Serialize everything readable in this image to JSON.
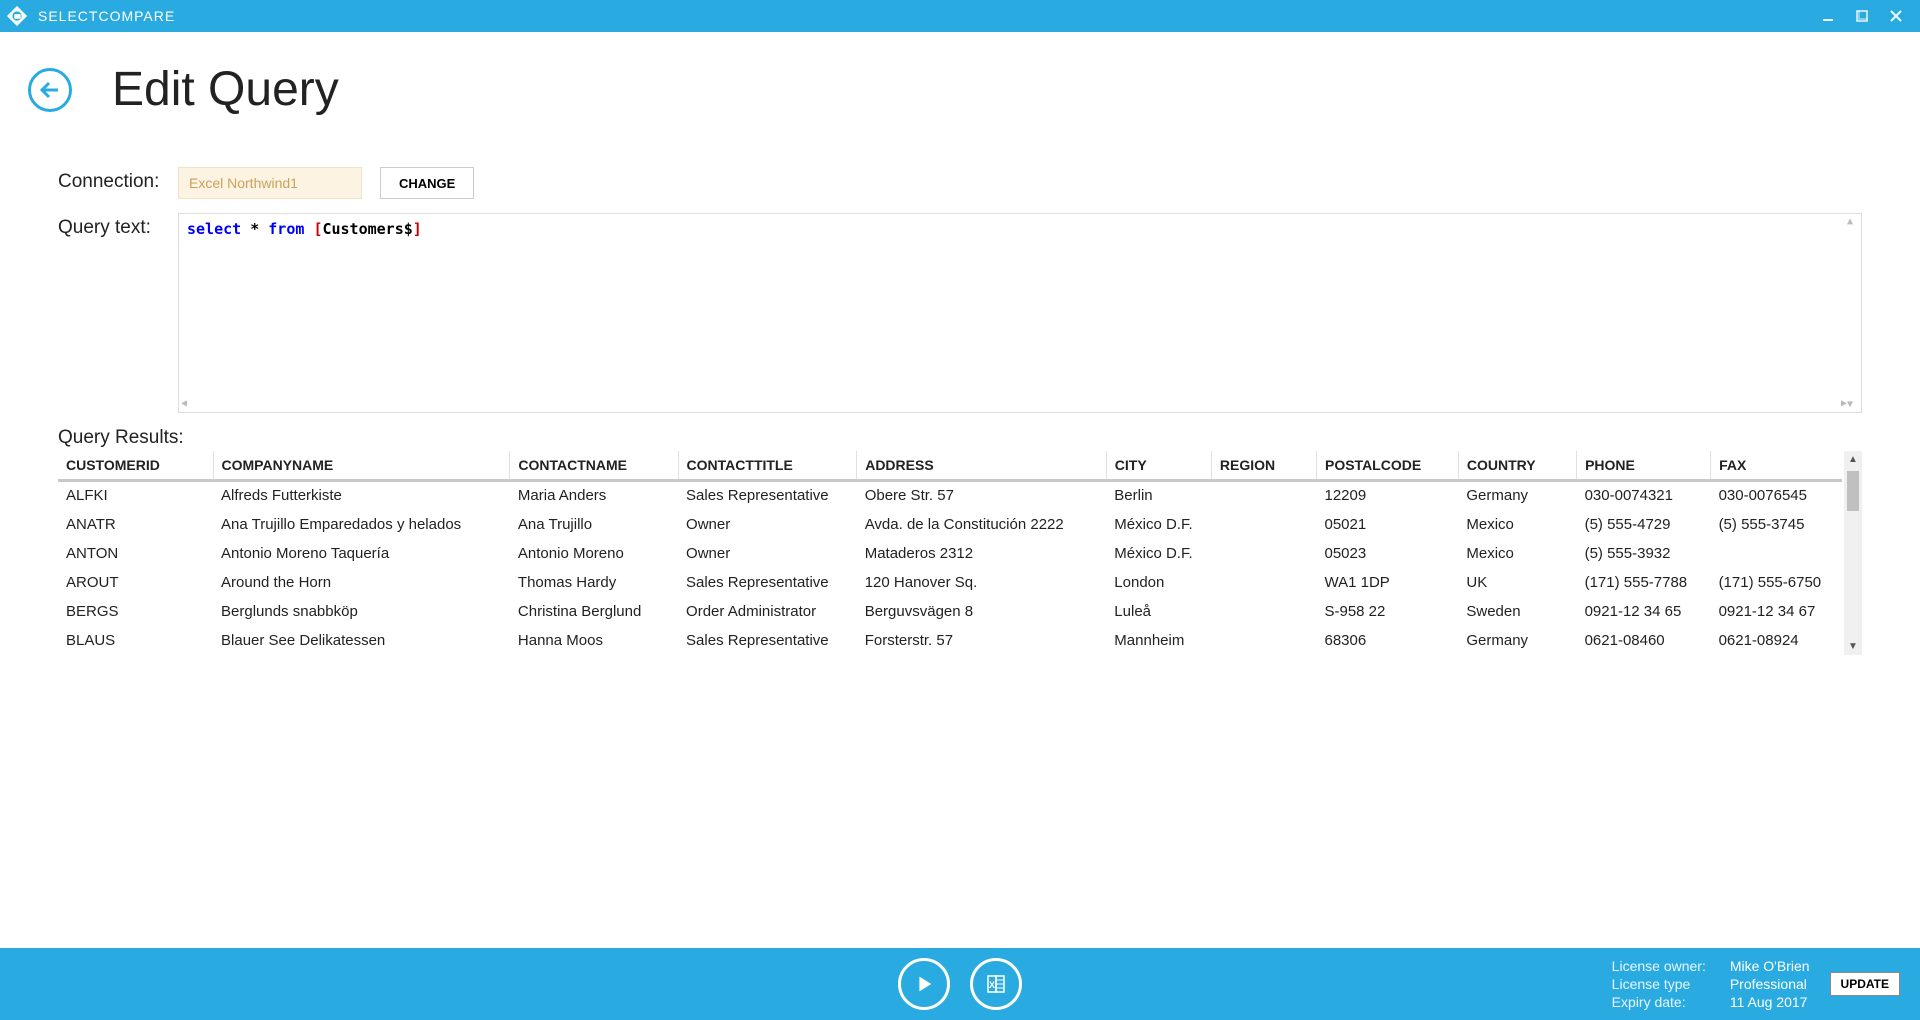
{
  "app": {
    "title": "SELECTCOMPARE"
  },
  "header": {
    "page_title": "Edit Query"
  },
  "form": {
    "connection_label": "Connection:",
    "connection_value": "Excel Northwind1",
    "change_label": "CHANGE",
    "query_label": "Query text:",
    "query": {
      "kw1": "select",
      "star": " * ",
      "kw2": "from",
      "space": " ",
      "br1": "[",
      "table": "Customers$",
      "br2": "]"
    }
  },
  "results": {
    "label": "Query Results:",
    "columns": [
      "CUSTOMERID",
      "COMPANYNAME",
      "CONTACTNAME",
      "CONTACTTITLE",
      "ADDRESS",
      "CITY",
      "REGION",
      "POSTALCODE",
      "COUNTRY",
      "PHONE",
      "FAX"
    ],
    "rows": [
      {
        "customerid": "ALFKI",
        "companyname": "Alfreds Futterkiste",
        "contactname": "Maria Anders",
        "contacttitle": "Sales Representative",
        "address": "Obere Str. 57",
        "city": "Berlin",
        "region": "",
        "postalcode": "12209",
        "country": "Germany",
        "phone": "030-0074321",
        "fax": "030-0076545"
      },
      {
        "customerid": "ANATR",
        "companyname": "Ana Trujillo Emparedados y helados",
        "contactname": "Ana Trujillo",
        "contacttitle": "Owner",
        "address": "Avda. de la Constitución 2222",
        "city": "México D.F.",
        "region": "",
        "postalcode": "05021",
        "country": "Mexico",
        "phone": "(5) 555-4729",
        "fax": "(5) 555-3745"
      },
      {
        "customerid": "ANTON",
        "companyname": "Antonio Moreno Taquería",
        "contactname": "Antonio Moreno",
        "contacttitle": "Owner",
        "address": "Mataderos  2312",
        "city": "México D.F.",
        "region": "",
        "postalcode": "05023",
        "country": "Mexico",
        "phone": "(5) 555-3932",
        "fax": ""
      },
      {
        "customerid": "AROUT",
        "companyname": "Around the Horn",
        "contactname": "Thomas Hardy",
        "contacttitle": "Sales Representative",
        "address": "120 Hanover Sq.",
        "city": "London",
        "region": "",
        "postalcode": "WA1 1DP",
        "country": "UK",
        "phone": "(171) 555-7788",
        "fax": "(171) 555-6750"
      },
      {
        "customerid": "BERGS",
        "companyname": "Berglunds snabbköp",
        "contactname": "Christina Berglund",
        "contacttitle": "Order Administrator",
        "address": "Berguvsvägen  8",
        "city": "Luleå",
        "region": "",
        "postalcode": "S-958 22",
        "country": "Sweden",
        "phone": "0921-12 34 65",
        "fax": "0921-12 34 67"
      },
      {
        "customerid": "BLAUS",
        "companyname": "Blauer See Delikatessen",
        "contactname": "Hanna Moos",
        "contacttitle": "Sales Representative",
        "address": "Forsterstr. 57",
        "city": "Mannheim",
        "region": "",
        "postalcode": "68306",
        "country": "Germany",
        "phone": "0621-08460",
        "fax": "0621-08924"
      }
    ]
  },
  "footer": {
    "license_owner_label": "License owner:",
    "license_owner": "Mike O'Brien",
    "license_type_label": "License type",
    "license_type": "Professional",
    "expiry_label": "Expiry date:",
    "expiry": "11 Aug 2017",
    "update_label": "UPDATE"
  }
}
